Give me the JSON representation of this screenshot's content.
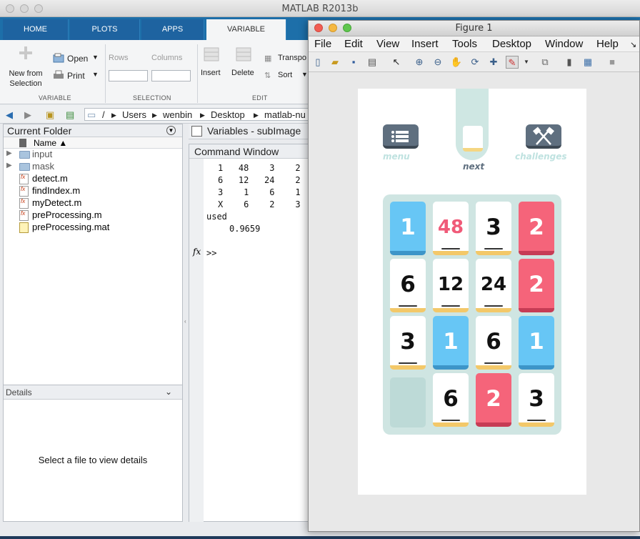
{
  "matlab": {
    "title": "MATLAB R2013b",
    "tabs": [
      "HOME",
      "PLOTS",
      "APPS",
      "VARIABLE"
    ],
    "ribbon": {
      "new_from_selection": "New from\nSelection",
      "open": "Open",
      "print": "Print",
      "rows": "Rows",
      "columns": "Columns",
      "insert": "Insert",
      "delete": "Delete",
      "transpose": "Transpo",
      "sort": "Sort",
      "sections": [
        "VARIABLE",
        "SELECTION",
        "EDIT"
      ]
    },
    "path": [
      "/",
      "Users",
      "wenbin",
      "Desktop",
      "matlab-nu"
    ],
    "current_folder": {
      "title": "Current Folder",
      "column": "Name ▲",
      "items": [
        {
          "name": "input",
          "type": "folder"
        },
        {
          "name": "mask",
          "type": "folder"
        },
        {
          "name": "detect.m",
          "type": "m"
        },
        {
          "name": "findIndex.m",
          "type": "m"
        },
        {
          "name": "myDetect.m",
          "type": "m"
        },
        {
          "name": "preProcessing.m",
          "type": "m"
        },
        {
          "name": "preProcessing.mat",
          "type": "mat"
        }
      ]
    },
    "details": {
      "title": "Details",
      "message": "Select a file to view details"
    },
    "variables_title": "Variables - subImage",
    "command_window": {
      "title": "Command Window",
      "lines": [
        "1   48    3    2",
        "6   12   24    2",
        "3    1    6    1",
        "X    6    2    3"
      ],
      "used_label": "used",
      "used_value": "0.9659",
      "prompt": ">>"
    }
  },
  "figure": {
    "title": "Figure 1",
    "menu": [
      "File",
      "Edit",
      "View",
      "Insert",
      "Tools",
      "Desktop",
      "Window",
      "Help"
    ],
    "game": {
      "menu_label": "menu",
      "next_label": "next",
      "challenges_label": "challenges",
      "board": [
        [
          {
            "v": "1",
            "c": "blue"
          },
          {
            "v": "48",
            "c": "white",
            "accent": "#f05a78"
          },
          {
            "v": "3",
            "c": "white"
          },
          {
            "v": "2",
            "c": "red"
          }
        ],
        [
          {
            "v": "6",
            "c": "white"
          },
          {
            "v": "12",
            "c": "white"
          },
          {
            "v": "24",
            "c": "white"
          },
          {
            "v": "2",
            "c": "red"
          }
        ],
        [
          {
            "v": "3",
            "c": "white"
          },
          {
            "v": "1",
            "c": "blue"
          },
          {
            "v": "6",
            "c": "white"
          },
          {
            "v": "1",
            "c": "blue"
          }
        ],
        [
          {
            "v": "",
            "c": "empty"
          },
          {
            "v": "6",
            "c": "white"
          },
          {
            "v": "2",
            "c": "red"
          },
          {
            "v": "3",
            "c": "white"
          }
        ]
      ]
    }
  }
}
